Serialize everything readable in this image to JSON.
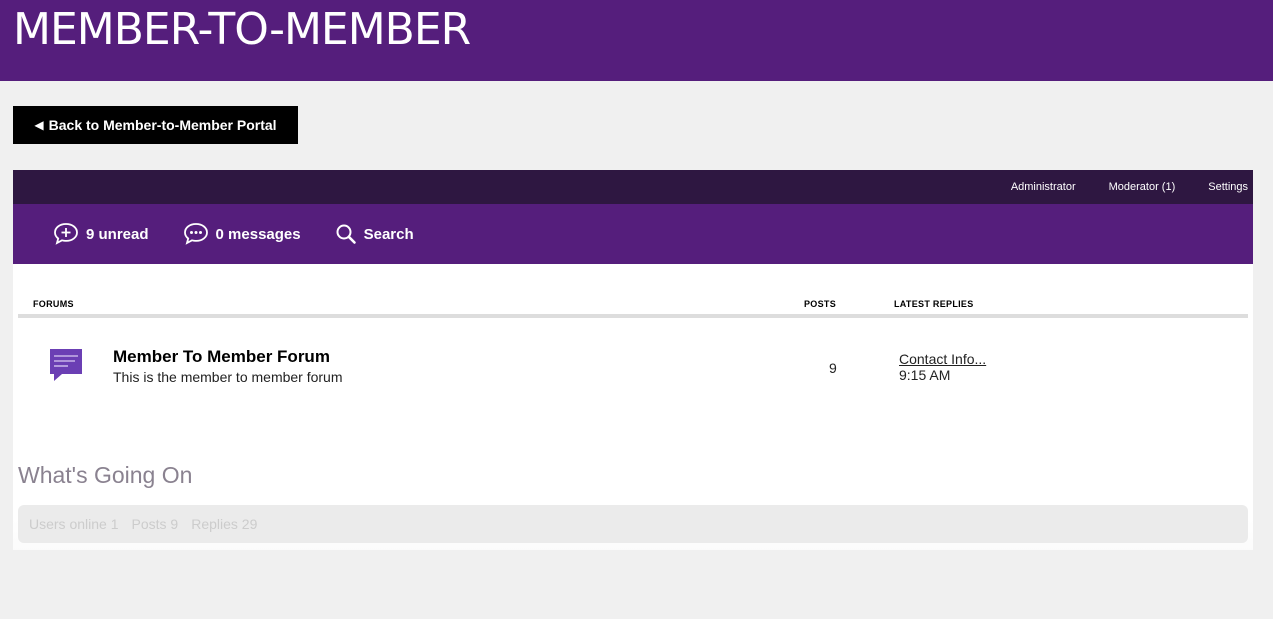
{
  "header": {
    "title": "MEMBER-TO-MEMBER"
  },
  "back_button": {
    "arrow": "◀",
    "label": "Back to Member-to-Member Portal"
  },
  "top_bar": {
    "administrator": "Administrator",
    "moderator": "Moderator (1)",
    "settings": "Settings"
  },
  "nav": {
    "unread": "9 unread",
    "messages": "0 messages",
    "search": "Search"
  },
  "table": {
    "col_forums": "FORUMS",
    "col_posts": "POSTS",
    "col_latest": "LATEST REPLIES"
  },
  "forums": [
    {
      "icon": "chat-bubble-icon",
      "name": "Member To Member Forum",
      "description": "This is the member to member forum",
      "posts": "9",
      "latest_reply_title": "Contact Info...",
      "latest_reply_time": "9:15 AM"
    }
  ],
  "whats_going_on": {
    "title": "What's Going On",
    "users_online": "Users online 1",
    "posts": "Posts 9",
    "replies": "Replies 29"
  },
  "colors": {
    "brand_purple": "#551e7c",
    "dark_purple": "#2e1741",
    "icon_purple": "#6b3fb4"
  }
}
